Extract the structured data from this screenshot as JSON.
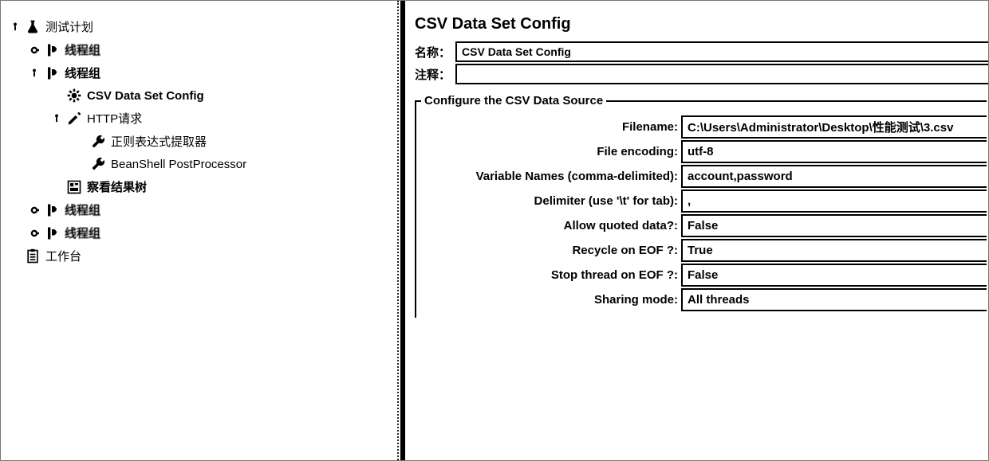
{
  "tree": {
    "test_plan": "测试计划",
    "thread_group_1": "线程组",
    "thread_group_2_bold": "线程组",
    "csv_config": "CSV Data Set Config",
    "http_request": "HTTP请求",
    "regex_extractor": "正则表达式提取器",
    "beanshell_post": "BeanShell PostProcessor",
    "view_results": "察看结果树",
    "thread_group_3": "线程组",
    "thread_group_4": "线程组",
    "workbench": "工作台"
  },
  "panel": {
    "title": "CSV Data Set Config",
    "name_label": "名称：",
    "name_value": "CSV Data Set Config",
    "comment_label": "注释：",
    "comment_value": "",
    "fieldset_title": "Configure the CSV Data Source",
    "rows": [
      {
        "label": "Filename:",
        "value": "C:\\Users\\Administrator\\Desktop\\性能测试\\3.csv"
      },
      {
        "label": "File encoding:",
        "value": "utf-8"
      },
      {
        "label": "Variable Names (comma-delimited):",
        "value": "account,password"
      },
      {
        "label": "Delimiter (use '\\t' for tab):",
        "value": ","
      },
      {
        "label": "Allow quoted data?:",
        "value": "False"
      },
      {
        "label": "Recycle on EOF ?:",
        "value": "True"
      },
      {
        "label": "Stop thread on EOF ?:",
        "value": "False"
      },
      {
        "label": "Sharing mode:",
        "value": "All threads"
      }
    ]
  }
}
